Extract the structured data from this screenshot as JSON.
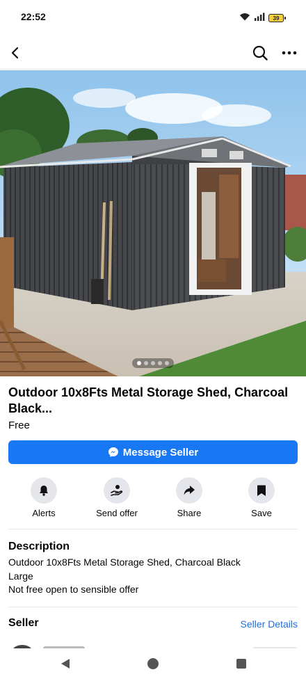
{
  "status": {
    "time": "22:52",
    "battery": "39"
  },
  "nav": {
    "back_icon": "arrow-back-icon",
    "search_icon": "search-icon",
    "more_icon": "more-horizontal-icon"
  },
  "gallery": {
    "image_count": 5,
    "active_index": 0
  },
  "listing": {
    "title": "Outdoor 10x8Fts Metal Storage Shed, Charcoal Black...",
    "price": "Free",
    "message_button": "Message Seller"
  },
  "actions": [
    {
      "label": "Alerts",
      "icon": "bell-icon"
    },
    {
      "label": "Send offer",
      "icon": "offer-hand-icon"
    },
    {
      "label": "Share",
      "icon": "share-arrow-icon"
    },
    {
      "label": "Save",
      "icon": "bookmark-icon"
    }
  ],
  "description": {
    "heading": "Description",
    "lines": [
      "Outdoor 10x8Fts Metal Storage Shed, Charcoal Black",
      "Large",
      "Not free open to sensible offer"
    ]
  },
  "seller": {
    "heading": "Seller",
    "details_link": "Seller Details"
  },
  "colors": {
    "accent": "#1877f2",
    "link": "#216fdb"
  }
}
